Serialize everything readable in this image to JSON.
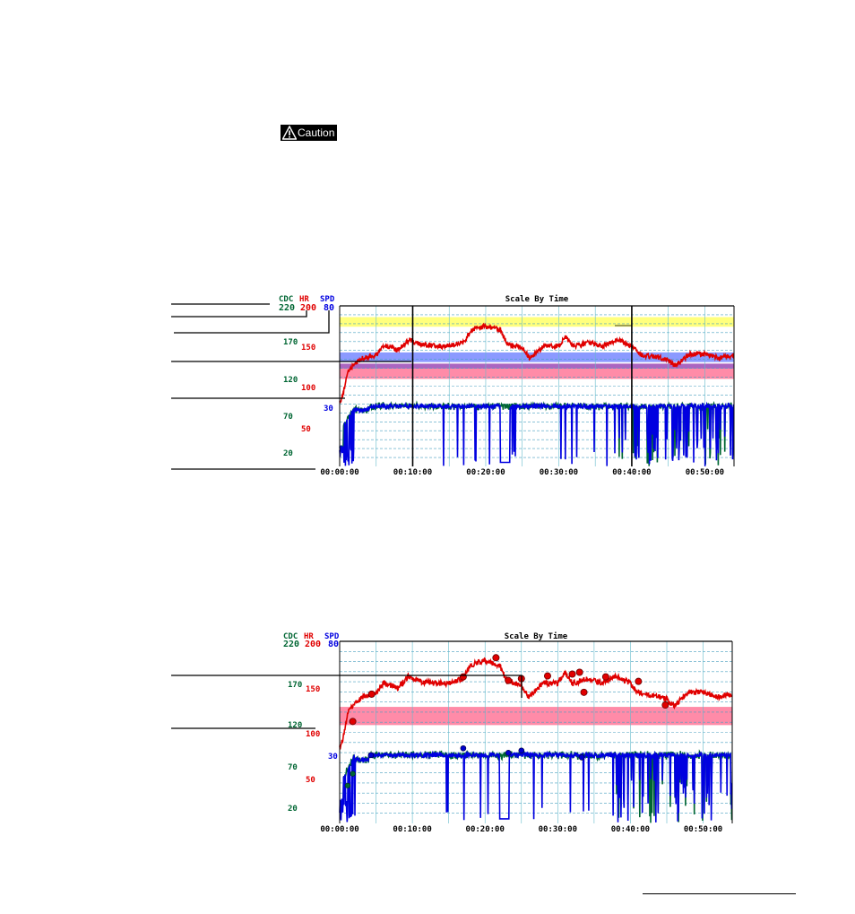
{
  "caution": {
    "label": "Caution",
    "icon": "warning-triangle-icon"
  },
  "chart_data": [
    {
      "type": "line",
      "title": "Scale By Time",
      "series": [
        {
          "name": "CDC",
          "color": "#006633"
        },
        {
          "name": "HR",
          "color": "#e00000"
        },
        {
          "name": "SPD",
          "color": "#0000e0"
        }
      ],
      "axes": {
        "CDC": {
          "ticks": [
            "220",
            "170",
            "120",
            "70",
            "20"
          ],
          "range": [
            20,
            220
          ]
        },
        "HR": {
          "ticks": [
            "200",
            "150",
            "100",
            "50"
          ],
          "range": [
            0,
            200
          ]
        },
        "SPD": {
          "ticks": [
            "80",
            "30"
          ],
          "range": [
            0,
            80
          ]
        }
      },
      "x_ticks": [
        "00:00:00",
        "00:10:00",
        "00:20:00",
        "00:30:00",
        "00:40:00",
        "00:50:00"
      ],
      "x_range_minutes": [
        0,
        54
      ],
      "zones": [
        {
          "name": "yellow-zone",
          "color": "#ffff66",
          "hr_range": [
            174,
            186
          ]
        },
        {
          "name": "blue-zone",
          "color": "#7788ff",
          "hr_range": [
            130,
            142
          ]
        },
        {
          "name": "red-zone",
          "color": "#ff7799",
          "hr_range": [
            109,
            128
          ]
        }
      ],
      "markers_minutes": [
        10,
        40
      ]
    },
    {
      "type": "line",
      "title": "Scale By Time",
      "series": [
        {
          "name": "CDC",
          "color": "#006633"
        },
        {
          "name": "HR",
          "color": "#e00000"
        },
        {
          "name": "SPD",
          "color": "#0000e0"
        }
      ],
      "axes": {
        "CDC": {
          "ticks": [
            "220",
            "170",
            "120",
            "70",
            "20"
          ],
          "range": [
            20,
            220
          ]
        },
        "HR": {
          "ticks": [
            "200",
            "150",
            "100",
            "50"
          ],
          "range": [
            0,
            200
          ]
        },
        "SPD": {
          "ticks": [
            "80",
            "30"
          ],
          "range": [
            0,
            80
          ]
        }
      },
      "x_ticks": [
        "00:00:00",
        "00:10:00",
        "00:20:00",
        "00:30:00",
        "00:40:00",
        "00:50:00"
      ],
      "x_range_minutes": [
        0,
        54
      ],
      "zones": [
        {
          "name": "red-zone",
          "color": "#ff7799",
          "hr_range": [
            108,
            128
          ]
        }
      ],
      "lap_points_hr": [
        {
          "t": 1.8,
          "hr": 108
        },
        {
          "t": 4.4,
          "hr": 138
        },
        {
          "t": 17,
          "hr": 157
        },
        {
          "t": 21.5,
          "hr": 178
        },
        {
          "t": 23.2,
          "hr": 153
        },
        {
          "t": 25,
          "hr": 155
        },
        {
          "t": 28.6,
          "hr": 158
        },
        {
          "t": 32,
          "hr": 160
        },
        {
          "t": 33,
          "hr": 162
        },
        {
          "t": 33.6,
          "hr": 140
        },
        {
          "t": 36.6,
          "hr": 157
        },
        {
          "t": 41.1,
          "hr": 152
        },
        {
          "t": 44.8,
          "hr": 126
        }
      ],
      "lap_points_spd": [
        {
          "t": 4.3,
          "spd": 30
        },
        {
          "t": 17,
          "spd": 33
        },
        {
          "t": 23.2,
          "spd": 31
        },
        {
          "t": 25,
          "spd": 32
        },
        {
          "t": 33.3,
          "spd": 29
        }
      ],
      "lap_points_cdc": [
        {
          "t": 1.1,
          "cdc": 32
        },
        {
          "t": 1.8,
          "cdc": 45
        }
      ]
    }
  ]
}
